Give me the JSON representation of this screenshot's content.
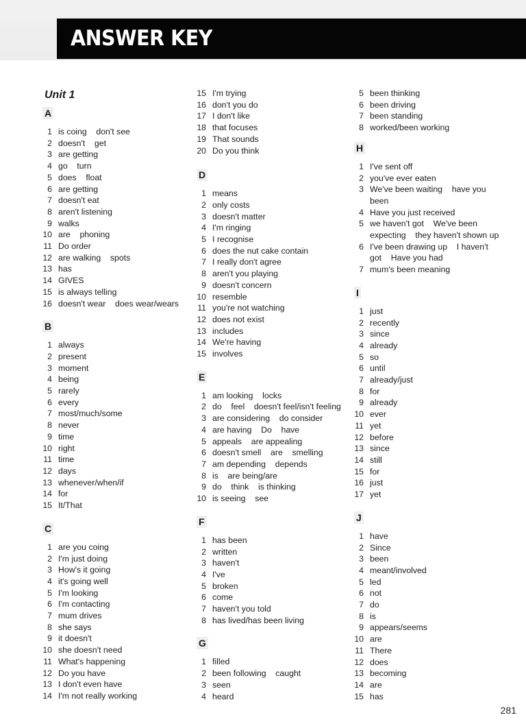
{
  "header": {
    "title": "ANSWER KEY"
  },
  "unit_title": "Unit 1",
  "columns": [
    {
      "sections": [
        {
          "letter": "A",
          "items": [
            {
              "n": "1",
              "a": "is coing    don't see"
            },
            {
              "n": "2",
              "a": "doesn't    get"
            },
            {
              "n": "3",
              "a": "are getting"
            },
            {
              "n": "4",
              "a": "go    turn"
            },
            {
              "n": "5",
              "a": "does    float"
            },
            {
              "n": "6",
              "a": "are getting"
            },
            {
              "n": "7",
              "a": "doesn't eat"
            },
            {
              "n": "8",
              "a": "aren't listening"
            },
            {
              "n": "9",
              "a": "walks"
            },
            {
              "n": "10",
              "a": "are    phoning"
            },
            {
              "n": "11",
              "a": "Do order"
            },
            {
              "n": "12",
              "a": "are walking    spots"
            },
            {
              "n": "13",
              "a": "has"
            },
            {
              "n": "14",
              "a": "GIVES"
            },
            {
              "n": "15",
              "a": "is always telling"
            },
            {
              "n": "16",
              "a": "doesn't wear    does wear/wears"
            }
          ]
        },
        {
          "letter": "B",
          "items": [
            {
              "n": "1",
              "a": "always"
            },
            {
              "n": "2",
              "a": "present"
            },
            {
              "n": "3",
              "a": "moment"
            },
            {
              "n": "4",
              "a": "being"
            },
            {
              "n": "5",
              "a": "rarely"
            },
            {
              "n": "6",
              "a": "every"
            },
            {
              "n": "7",
              "a": "most/much/some"
            },
            {
              "n": "8",
              "a": "never"
            },
            {
              "n": "9",
              "a": "time"
            },
            {
              "n": "10",
              "a": "right"
            },
            {
              "n": "11",
              "a": "time"
            },
            {
              "n": "12",
              "a": "days"
            },
            {
              "n": "13",
              "a": "whenever/when/if"
            },
            {
              "n": "14",
              "a": "for"
            },
            {
              "n": "15",
              "a": "It/That"
            }
          ]
        },
        {
          "letter": "C",
          "items": [
            {
              "n": "1",
              "a": "are you coing"
            },
            {
              "n": "2",
              "a": "I'm just doing"
            },
            {
              "n": "3",
              "a": "How's it going"
            },
            {
              "n": "4",
              "a": "it's going well"
            },
            {
              "n": "5",
              "a": "I'm looking"
            },
            {
              "n": "6",
              "a": "I'm contacting"
            },
            {
              "n": "7",
              "a": "mum drives"
            },
            {
              "n": "8",
              "a": "she says"
            },
            {
              "n": "9",
              "a": "it doesn't"
            },
            {
              "n": "10",
              "a": "she doesn't need"
            },
            {
              "n": "11",
              "a": "What's happening"
            },
            {
              "n": "12",
              "a": "Do you have"
            },
            {
              "n": "13",
              "a": "I don't even have"
            },
            {
              "n": "14",
              "a": "I'm not really working"
            }
          ]
        }
      ]
    },
    {
      "continuation": [
        {
          "n": "15",
          "a": "I'm trying"
        },
        {
          "n": "16",
          "a": "don't you do"
        },
        {
          "n": "17",
          "a": "I don't like"
        },
        {
          "n": "18",
          "a": "that focuses"
        },
        {
          "n": "19",
          "a": "That sounds"
        },
        {
          "n": "20",
          "a": "Do you think"
        }
      ],
      "sections": [
        {
          "letter": "D",
          "items": [
            {
              "n": "1",
              "a": "means"
            },
            {
              "n": "2",
              "a": "only costs"
            },
            {
              "n": "3",
              "a": "doesn't matter"
            },
            {
              "n": "4",
              "a": "I'm ringing"
            },
            {
              "n": "5",
              "a": "I recognise"
            },
            {
              "n": "6",
              "a": "does the nut cake contain"
            },
            {
              "n": "7",
              "a": "I really don't agree"
            },
            {
              "n": "8",
              "a": "aren't you playing"
            },
            {
              "n": "9",
              "a": "doesn't concern"
            },
            {
              "n": "10",
              "a": "resemble"
            },
            {
              "n": "11",
              "a": "you're not watching"
            },
            {
              "n": "12",
              "a": "does not exist"
            },
            {
              "n": "13",
              "a": "includes"
            },
            {
              "n": "14",
              "a": "We're having"
            },
            {
              "n": "15",
              "a": "involves"
            }
          ]
        },
        {
          "letter": "E",
          "items": [
            {
              "n": "1",
              "a": "am looking    locks"
            },
            {
              "n": "2",
              "a": "do    feel    doesn't feel/isn't feeling"
            },
            {
              "n": "3",
              "a": "are considering    do consider"
            },
            {
              "n": "4",
              "a": "are having    Do    have"
            },
            {
              "n": "5",
              "a": "appeals    are appealing"
            },
            {
              "n": "6",
              "a": "doesn't smell    are    smelling"
            },
            {
              "n": "7",
              "a": "am depending    depends"
            },
            {
              "n": "8",
              "a": "is    are being/are"
            },
            {
              "n": "9",
              "a": "do    think    is thinking"
            },
            {
              "n": "10",
              "a": "is seeing    see"
            }
          ]
        },
        {
          "letter": "F",
          "items": [
            {
              "n": "1",
              "a": "has been"
            },
            {
              "n": "2",
              "a": "written"
            },
            {
              "n": "3",
              "a": "haven't"
            },
            {
              "n": "4",
              "a": "I've"
            },
            {
              "n": "5",
              "a": "broken"
            },
            {
              "n": "6",
              "a": "come"
            },
            {
              "n": "7",
              "a": "haven't you told"
            },
            {
              "n": "8",
              "a": "has lived/has been living"
            }
          ]
        },
        {
          "letter": "G",
          "items": [
            {
              "n": "1",
              "a": "filled"
            },
            {
              "n": "2",
              "a": "been following    caught"
            },
            {
              "n": "3",
              "a": "seen"
            },
            {
              "n": "4",
              "a": "heard"
            }
          ]
        }
      ]
    },
    {
      "continuation": [
        {
          "n": "5",
          "a": "been thinking"
        },
        {
          "n": "6",
          "a": "been driving"
        },
        {
          "n": "7",
          "a": "been standing"
        },
        {
          "n": "8",
          "a": "worked/been working"
        }
      ],
      "sections": [
        {
          "letter": "H",
          "items": [
            {
              "n": "1",
              "a": "I've sent off"
            },
            {
              "n": "2",
              "a": "you've ever eaten"
            },
            {
              "n": "3",
              "a": "We've been waiting    have you been"
            },
            {
              "n": "4",
              "a": "Have you just received"
            },
            {
              "n": "5",
              "a": "we haven't got    We've been expecting    they haven't shown up"
            },
            {
              "n": "6",
              "a": "I've been drawing up    I haven't got    Have you had"
            },
            {
              "n": "7",
              "a": "mum's been meaning"
            }
          ]
        },
        {
          "letter": "I",
          "items": [
            {
              "n": "1",
              "a": "just"
            },
            {
              "n": "2",
              "a": "recently"
            },
            {
              "n": "3",
              "a": "since"
            },
            {
              "n": "4",
              "a": "already"
            },
            {
              "n": "5",
              "a": "so"
            },
            {
              "n": "6",
              "a": "until"
            },
            {
              "n": "7",
              "a": "already/just"
            },
            {
              "n": "8",
              "a": "for"
            },
            {
              "n": "9",
              "a": "already"
            },
            {
              "n": "10",
              "a": "ever"
            },
            {
              "n": "11",
              "a": "yet"
            },
            {
              "n": "12",
              "a": "before"
            },
            {
              "n": "13",
              "a": "since"
            },
            {
              "n": "14",
              "a": "still"
            },
            {
              "n": "15",
              "a": "for"
            },
            {
              "n": "16",
              "a": "just"
            },
            {
              "n": "17",
              "a": "yet"
            }
          ]
        },
        {
          "letter": "J",
          "items": [
            {
              "n": "1",
              "a": "have"
            },
            {
              "n": "2",
              "a": "Since"
            },
            {
              "n": "3",
              "a": "been"
            },
            {
              "n": "4",
              "a": "meant/involved"
            },
            {
              "n": "5",
              "a": "led"
            },
            {
              "n": "6",
              "a": "not"
            },
            {
              "n": "7",
              "a": "do"
            },
            {
              "n": "8",
              "a": "is"
            },
            {
              "n": "9",
              "a": "appears/seems"
            },
            {
              "n": "10",
              "a": "are"
            },
            {
              "n": "11",
              "a": "There"
            },
            {
              "n": "12",
              "a": "does"
            },
            {
              "n": "13",
              "a": "becoming"
            },
            {
              "n": "14",
              "a": "are"
            },
            {
              "n": "15",
              "a": "has"
            }
          ]
        }
      ]
    }
  ],
  "page_number": "281"
}
